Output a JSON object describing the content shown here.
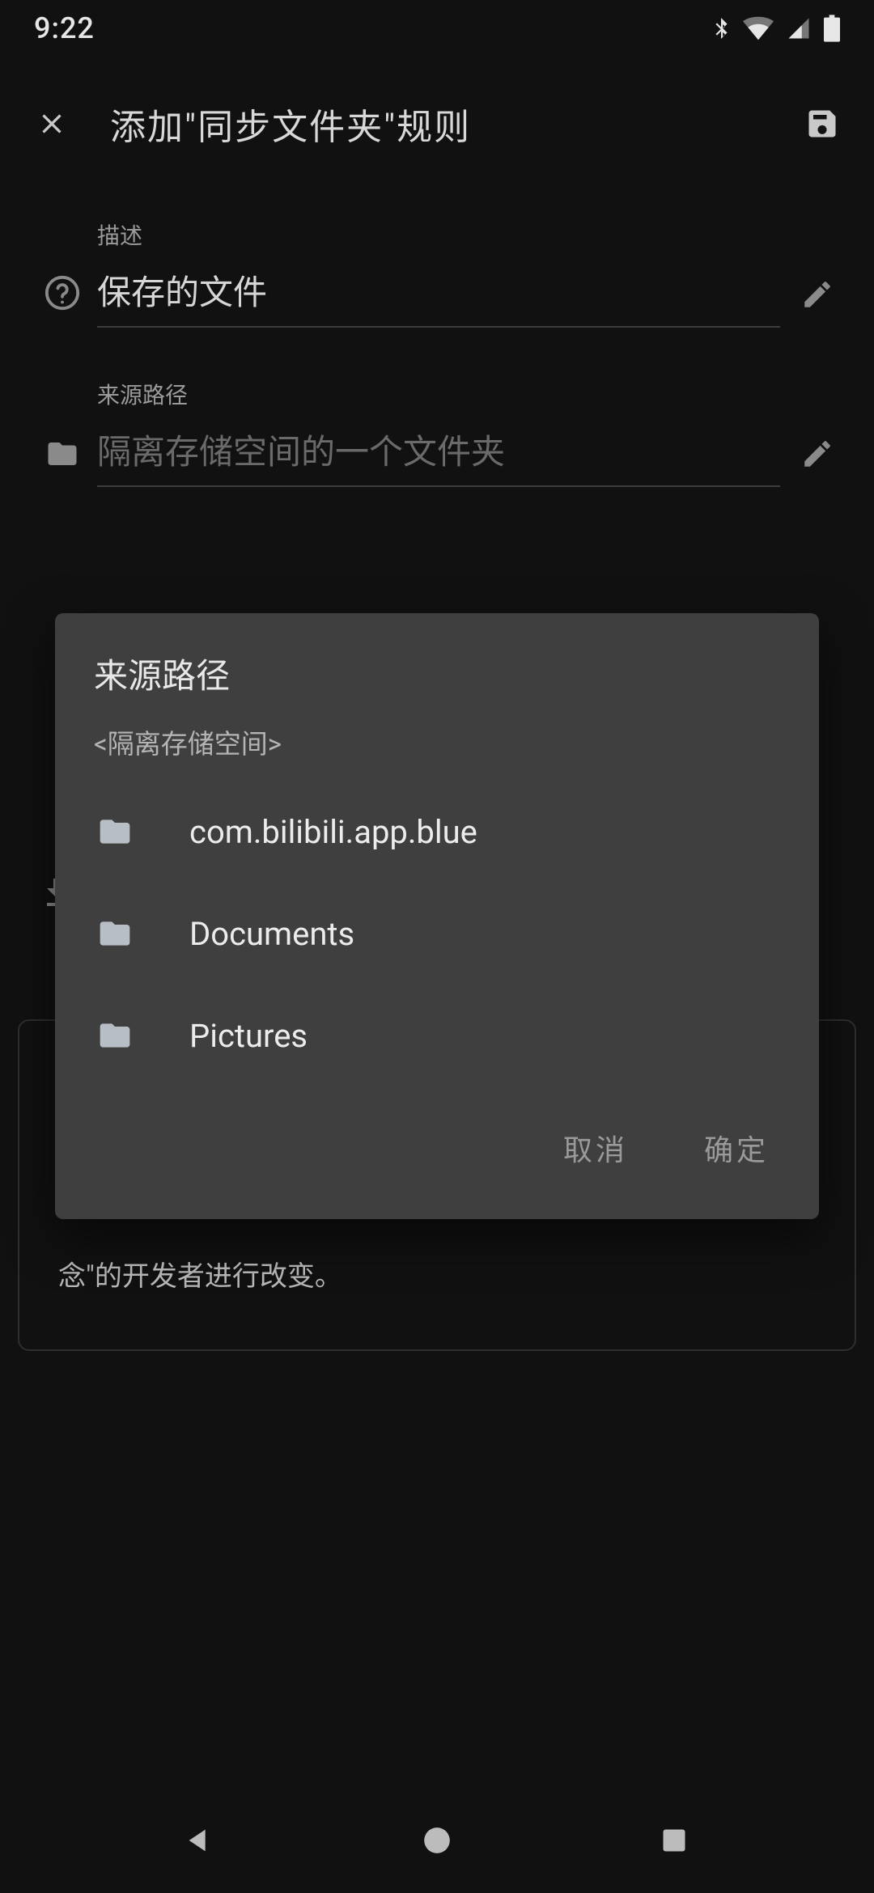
{
  "status": {
    "time": "9:22"
  },
  "appbar": {
    "title": "添加\"同步文件夹\"规则"
  },
  "form": {
    "desc_label": "描述",
    "desc_value": "保存的文件",
    "source_label": "来源路径",
    "source_placeholder": "隔离存储空间的一个文件夹"
  },
  "bg_card": {
    "visible_line": "念\"的开发者进行改变。"
  },
  "dialog": {
    "title": "来源路径",
    "subtitle": "<隔离存储空间>",
    "items": [
      {
        "label": "com.bilibili.app.blue"
      },
      {
        "label": "Documents"
      },
      {
        "label": "Pictures"
      }
    ],
    "cancel": "取消",
    "ok": "确定"
  }
}
